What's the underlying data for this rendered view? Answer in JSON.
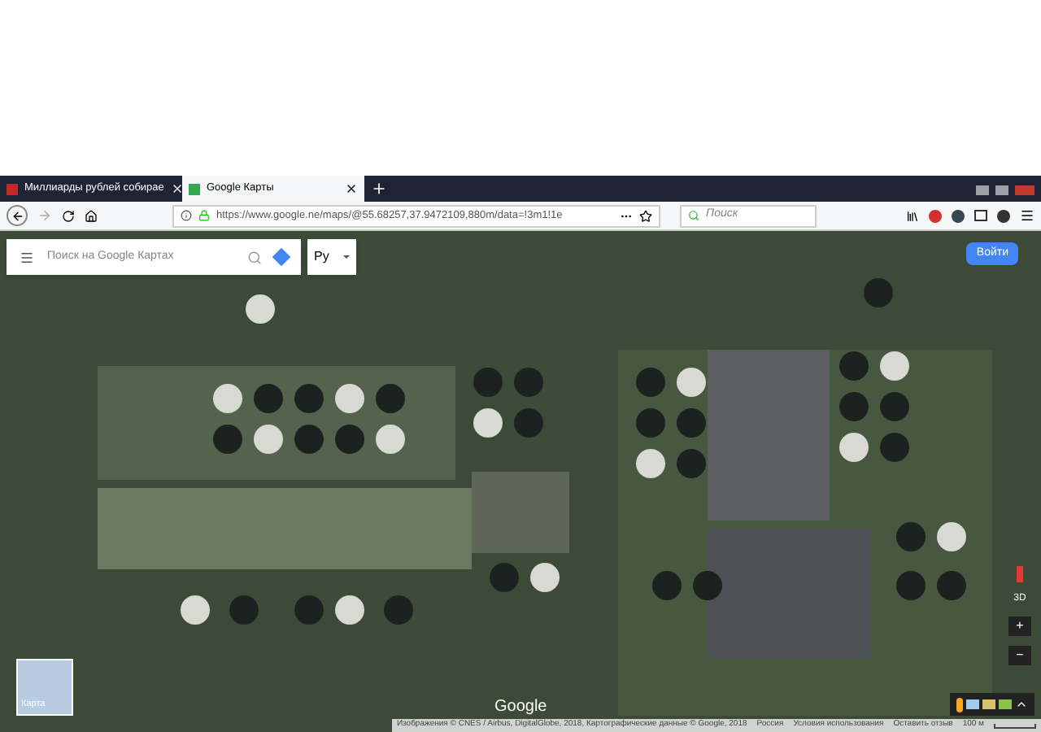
{
  "browser": {
    "tabs": [
      {
        "label": "Миллиарды рублей собирае",
        "selected": false
      },
      {
        "label": "Google Карты",
        "selected": true
      }
    ],
    "url": "https://www.google.ne/maps/@55.68257,37.9472109,880m/data=!3m1!1e",
    "search": {
      "placeholder": "Поиск"
    }
  },
  "map": {
    "search": {
      "placeholder": "Поиск на Google Картах"
    },
    "language": "Ру",
    "sign_in": "Войти",
    "view_3d": "3D",
    "zoom_in": "+",
    "zoom_out": "−",
    "layer_thumbnail": "Карта",
    "logo": "Google",
    "attribution": [
      "Изображения © CNES / Airbus, DigitalGlobe, 2018, Картографические данные © Google, 2018",
      "Россия",
      "Условия использования",
      "Оставить отзыв",
      "100 м"
    ]
  }
}
